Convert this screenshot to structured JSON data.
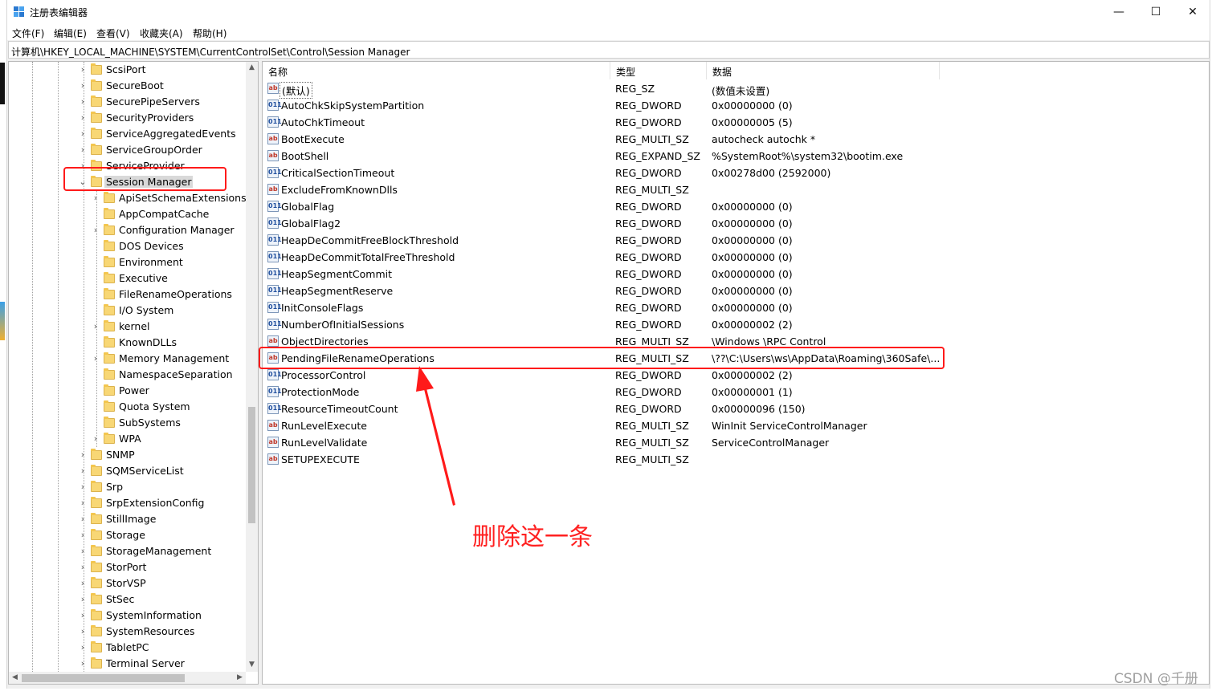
{
  "window": {
    "title": "注册表编辑器",
    "controls": {
      "minimize": "—",
      "maximize": "☐",
      "close": "✕"
    }
  },
  "menu": [
    "文件(F)",
    "编辑(E)",
    "查看(V)",
    "收藏夹(A)",
    "帮助(H)"
  ],
  "address": "计算机\\HKEY_LOCAL_MACHINE\\SYSTEM\\CurrentControlSet\\Control\\Session Manager",
  "tree": {
    "items": [
      {
        "label": "ScsiPort",
        "depth": 0,
        "expandable": true
      },
      {
        "label": "SecureBoot",
        "depth": 0,
        "expandable": true
      },
      {
        "label": "SecurePipeServers",
        "depth": 0,
        "expandable": true
      },
      {
        "label": "SecurityProviders",
        "depth": 0,
        "expandable": true
      },
      {
        "label": "ServiceAggregatedEvents",
        "depth": 0,
        "expandable": true
      },
      {
        "label": "ServiceGroupOrder",
        "depth": 0,
        "expandable": true
      },
      {
        "label": "ServiceProvider",
        "depth": 0,
        "expandable": true
      },
      {
        "label": "Session Manager",
        "depth": 0,
        "expandable": true,
        "expanded": true,
        "selected": true
      },
      {
        "label": "ApiSetSchemaExtensions",
        "depth": 1,
        "expandable": true
      },
      {
        "label": "AppCompatCache",
        "depth": 1,
        "expandable": false
      },
      {
        "label": "Configuration Manager",
        "depth": 1,
        "expandable": true
      },
      {
        "label": "DOS Devices",
        "depth": 1,
        "expandable": false
      },
      {
        "label": "Environment",
        "depth": 1,
        "expandable": false
      },
      {
        "label": "Executive",
        "depth": 1,
        "expandable": false
      },
      {
        "label": "FileRenameOperations",
        "depth": 1,
        "expandable": false
      },
      {
        "label": "I/O System",
        "depth": 1,
        "expandable": false
      },
      {
        "label": "kernel",
        "depth": 1,
        "expandable": true
      },
      {
        "label": "KnownDLLs",
        "depth": 1,
        "expandable": false
      },
      {
        "label": "Memory Management",
        "depth": 1,
        "expandable": true
      },
      {
        "label": "NamespaceSeparation",
        "depth": 1,
        "expandable": false
      },
      {
        "label": "Power",
        "depth": 1,
        "expandable": false
      },
      {
        "label": "Quota System",
        "depth": 1,
        "expandable": false
      },
      {
        "label": "SubSystems",
        "depth": 1,
        "expandable": false
      },
      {
        "label": "WPA",
        "depth": 1,
        "expandable": true
      },
      {
        "label": "SNMP",
        "depth": 0,
        "expandable": true
      },
      {
        "label": "SQMServiceList",
        "depth": 0,
        "expandable": true
      },
      {
        "label": "Srp",
        "depth": 0,
        "expandable": true
      },
      {
        "label": "SrpExtensionConfig",
        "depth": 0,
        "expandable": true
      },
      {
        "label": "StillImage",
        "depth": 0,
        "expandable": true
      },
      {
        "label": "Storage",
        "depth": 0,
        "expandable": true
      },
      {
        "label": "StorageManagement",
        "depth": 0,
        "expandable": true
      },
      {
        "label": "StorPort",
        "depth": 0,
        "expandable": true
      },
      {
        "label": "StorVSP",
        "depth": 0,
        "expandable": true
      },
      {
        "label": "StSec",
        "depth": 0,
        "expandable": true
      },
      {
        "label": "SystemInformation",
        "depth": 0,
        "expandable": true
      },
      {
        "label": "SystemResources",
        "depth": 0,
        "expandable": true
      },
      {
        "label": "TabletPC",
        "depth": 0,
        "expandable": true
      },
      {
        "label": "Terminal Server",
        "depth": 0,
        "expandable": true
      }
    ]
  },
  "columns": {
    "name": "名称",
    "type": "类型",
    "data": "数据"
  },
  "values": [
    {
      "icon": "ab",
      "name": "(默认)",
      "type": "REG_SZ",
      "data": "(数值未设置)"
    },
    {
      "icon": "bin",
      "name": "AutoChkSkipSystemPartition",
      "type": "REG_DWORD",
      "data": "0x00000000 (0)"
    },
    {
      "icon": "bin",
      "name": "AutoChkTimeout",
      "type": "REG_DWORD",
      "data": "0x00000005 (5)"
    },
    {
      "icon": "ab",
      "name": "BootExecute",
      "type": "REG_MULTI_SZ",
      "data": "autocheck autochk *"
    },
    {
      "icon": "ab",
      "name": "BootShell",
      "type": "REG_EXPAND_SZ",
      "data": "%SystemRoot%\\system32\\bootim.exe"
    },
    {
      "icon": "bin",
      "name": "CriticalSectionTimeout",
      "type": "REG_DWORD",
      "data": "0x00278d00 (2592000)"
    },
    {
      "icon": "ab",
      "name": "ExcludeFromKnownDlls",
      "type": "REG_MULTI_SZ",
      "data": ""
    },
    {
      "icon": "bin",
      "name": "GlobalFlag",
      "type": "REG_DWORD",
      "data": "0x00000000 (0)"
    },
    {
      "icon": "bin",
      "name": "GlobalFlag2",
      "type": "REG_DWORD",
      "data": "0x00000000 (0)"
    },
    {
      "icon": "bin",
      "name": "HeapDeCommitFreeBlockThreshold",
      "type": "REG_DWORD",
      "data": "0x00000000 (0)"
    },
    {
      "icon": "bin",
      "name": "HeapDeCommitTotalFreeThreshold",
      "type": "REG_DWORD",
      "data": "0x00000000 (0)"
    },
    {
      "icon": "bin",
      "name": "HeapSegmentCommit",
      "type": "REG_DWORD",
      "data": "0x00000000 (0)"
    },
    {
      "icon": "bin",
      "name": "HeapSegmentReserve",
      "type": "REG_DWORD",
      "data": "0x00000000 (0)"
    },
    {
      "icon": "bin",
      "name": "InitConsoleFlags",
      "type": "REG_DWORD",
      "data": "0x00000000 (0)"
    },
    {
      "icon": "bin",
      "name": "NumberOfInitialSessions",
      "type": "REG_DWORD",
      "data": "0x00000002 (2)"
    },
    {
      "icon": "ab",
      "name": "ObjectDirectories",
      "type": "REG_MULTI_SZ",
      "data": "\\Windows \\RPC Control"
    },
    {
      "icon": "ab",
      "name": "PendingFileRenameOperations",
      "type": "REG_MULTI_SZ",
      "data": "\\??\\C:\\Users\\ws\\AppData\\Roaming\\360Safe\\..."
    },
    {
      "icon": "bin",
      "name": "ProcessorControl",
      "type": "REG_DWORD",
      "data": "0x00000002 (2)"
    },
    {
      "icon": "bin",
      "name": "ProtectionMode",
      "type": "REG_DWORD",
      "data": "0x00000001 (1)"
    },
    {
      "icon": "bin",
      "name": "ResourceTimeoutCount",
      "type": "REG_DWORD",
      "data": "0x00000096 (150)"
    },
    {
      "icon": "ab",
      "name": "RunLevelExecute",
      "type": "REG_MULTI_SZ",
      "data": "WinInit ServiceControlManager"
    },
    {
      "icon": "ab",
      "name": "RunLevelValidate",
      "type": "REG_MULTI_SZ",
      "data": "ServiceControlManager"
    },
    {
      "icon": "ab",
      "name": "SETUPEXECUTE",
      "type": "REG_MULTI_SZ",
      "data": ""
    }
  ],
  "annotation": {
    "text": "删除这一条",
    "color": "#ff2020"
  },
  "watermark": "CSDN @千册",
  "colors": {
    "highlight": "#ff1a1a",
    "folder": "#f8d775",
    "selection": "#d9d9d9"
  }
}
